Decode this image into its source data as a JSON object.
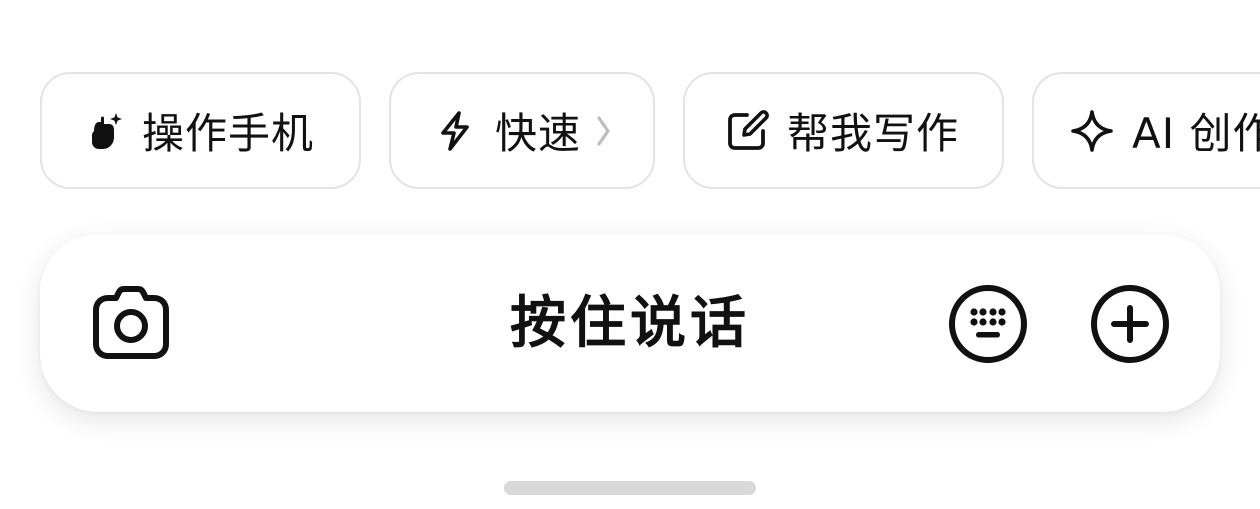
{
  "quick_actions": [
    {
      "label": "操作手机",
      "icon": "hand-sparkle-icon"
    },
    {
      "label": "快速",
      "icon": "lightning-icon",
      "trailing": "›"
    },
    {
      "label": "帮我写作",
      "icon": "edit-square-icon"
    },
    {
      "label": "AI 创作",
      "icon": "sparkle-icon"
    }
  ],
  "input_bar": {
    "hold_to_talk_label": "按住说话",
    "left_icon": "camera-icon",
    "right_icons": [
      "keyboard-icon",
      "plus-circle-icon"
    ]
  },
  "colors": {
    "background": "#ffffff",
    "text": "#111111",
    "chip_border": "#e4e4e4",
    "home_indicator": "#d9d9d9"
  }
}
